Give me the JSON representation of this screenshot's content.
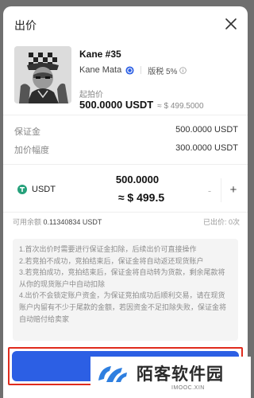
{
  "header": {
    "title": "出价"
  },
  "nft": {
    "name": "Kane #35",
    "creator": "Kane Mata",
    "royalty": "版税 5%",
    "start_price_label": "起拍价",
    "start_price": "500.0000 USDT",
    "start_price_approx": "≈ $ 499.5000"
  },
  "info": {
    "deposit_label": "保证金",
    "deposit_value": "500.0000 USDT",
    "increment_label": "加价幅度",
    "increment_value": "300.0000 USDT"
  },
  "bid": {
    "currency": "USDT",
    "amount": "500.0000",
    "approx": "≈ $ 499.5",
    "minus": "-",
    "plus": "+"
  },
  "balance": {
    "label": "可用余额",
    "value": "0.11340834 USDT",
    "bids_label": "已出价: 0次"
  },
  "notice": [
    "1.首次出价时需要进行保证金扣除，后续出价可直接操作",
    "2.若竞拍不成功，竞拍结束后，保证金将自动返还现货账户",
    "3.若竞拍成功，竞拍结束后，保证金将自动转为货款，剩余尾款将从你的现货账户中自动扣除",
    "4.出价不会锁定账户资金，为保证竞拍成功后顺利交易，请在现货账户内留有不少于尾款的金额，若因资金不足扣除失败，保证金将自动赔付给卖家"
  ],
  "watermark": {
    "text": "陌客软件园",
    "url": "IMOOC.XIN"
  },
  "icons": {
    "close": "close-icon",
    "verified": "verified-badge-icon",
    "royalty": "info-icon",
    "usdt": "usdt-coin-icon"
  },
  "colors": {
    "primary_button": "#2c5fe4",
    "highlight_frame": "#e02b1d",
    "usdt": "#26a17b",
    "verified": "#2c5fe4"
  }
}
